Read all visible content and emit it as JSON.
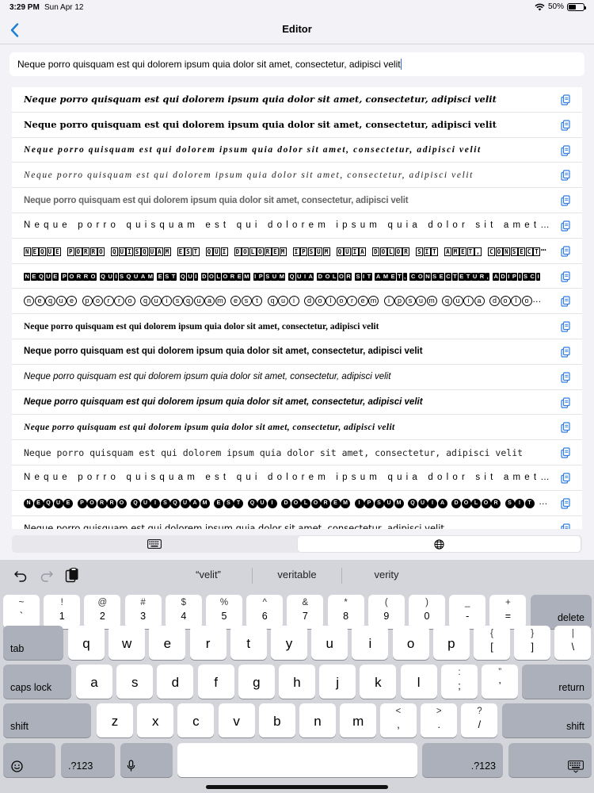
{
  "status": {
    "time": "3:29 PM",
    "date": "Sun Apr 12",
    "battery": "50%",
    "battery_level": 0.5
  },
  "nav": {
    "title": "Editor"
  },
  "input": {
    "value": "Neque porro quisquam est qui dolorem ipsum quia dolor sit amet, consectetur, adipisci velit"
  },
  "rows": [
    {
      "style": "fraktur",
      "text": "Neque porro quisquam est qui dolorem ipsum quia dolor sit amet, consectetur, adipisci velit"
    },
    {
      "style": "fraktur-bold",
      "text": "Neque porro quisquam est qui dolorem ipsum quia dolor sit amet, consectetur, adipisci velit"
    },
    {
      "style": "script-bold",
      "text": "Neque porro quisquam est qui dolorem ipsum quia dolor sit amet, consectetur, adipisci velit"
    },
    {
      "style": "script",
      "text": "Neque porro quisquam est qui dolorem ipsum quia dolor sit amet, consectetur, adipisci velit"
    },
    {
      "style": "double-struck",
      "text": "Neque porro quisquam est qui dolorem ipsum quia dolor sit amet, consectetur, adipisci velit"
    },
    {
      "style": "wide",
      "text": "Neque porro quisquam est qui dolorem ipsum quia dolor sit amet, consectetur, adipisci velit"
    },
    {
      "style": "squared",
      "text": "NEQUE PORRO QUISQUAM EST QUI DOLOREM IPSUM QUIA DOLOR SIT AMET, CONSECTETUR, ADIPISCI VELIT"
    },
    {
      "style": "negative-squared",
      "text": "NEQUE PORRO QUISQUAM EST QUI DOLOREM IPSUM QUIA DOLOR SIT AMET, CONSECTETUR, ADIPISCI VELIT"
    },
    {
      "style": "circled",
      "text": "neque porro quisquam est qui dolorem ipsum quia dolor sit amet, consectetur, adipisci velit"
    },
    {
      "style": "serif-bold",
      "text": "Neque porro quisquam est qui dolorem ipsum quia dolor sit amet, consectetur, adipisci velit"
    },
    {
      "style": "sans-bold",
      "text": "Neque porro quisquam est qui dolorem ipsum quia dolor sit amet, consectetur, adipisci velit"
    },
    {
      "style": "sans-italic",
      "text": "Neque porro quisquam est qui dolorem ipsum quia dolor sit amet, consectetur, adipisci velit"
    },
    {
      "style": "sans-bold-italic",
      "text": "Neque porro quisquam est qui dolorem ipsum quia dolor sit amet, consectetur, adipisci velit"
    },
    {
      "style": "serif-bold-italic",
      "text": "Neque porro quisquam est qui dolorem ipsum quia dolor sit amet, consectetur, adipisci velit"
    },
    {
      "style": "monospace",
      "text": "Neque porro quisquam est qui dolorem ipsum quia dolor sit amet, consectetur, adipisci velit"
    },
    {
      "style": "wide2",
      "text": "Neque porro quisquam est qui dolorem ipsum quia dolor sit amet, consectetur, adipisci velit"
    },
    {
      "style": "negative-circled",
      "text": "NEQUE PORRO QUISQUAM EST QUI DOLOREM IPSUM QUIA DOLOR SIT AMET, CONSECTETUR, ADIPISCI VELIT"
    },
    {
      "style": "small",
      "text": "Neque porro quisquam est qui dolorem ipsum quia dolor sit amet, consectetur, adipisci velit"
    }
  ],
  "segments": [
    {
      "icon": "keyboard-icon",
      "selected": false
    },
    {
      "icon": "globe-icon",
      "selected": true
    }
  ],
  "suggestions": [
    "“velit”",
    "veritable",
    "verity"
  ],
  "keyboard": {
    "row1": [
      [
        "~",
        "`"
      ],
      [
        "!",
        "1"
      ],
      [
        "@",
        "2"
      ],
      [
        "#",
        "3"
      ],
      [
        "$",
        "4"
      ],
      [
        "%",
        "5"
      ],
      [
        "^",
        "6"
      ],
      [
        "&",
        "7"
      ],
      [
        "*",
        "8"
      ],
      [
        "(",
        "9"
      ],
      [
        ")",
        "0"
      ],
      [
        "_",
        "-"
      ],
      [
        "+",
        "="
      ]
    ],
    "delete": "delete",
    "tab": "tab",
    "row2": [
      "q",
      "w",
      "e",
      "r",
      "t",
      "y",
      "u",
      "i",
      "o",
      "p"
    ],
    "row2_extra": [
      [
        "{",
        "["
      ],
      [
        "}",
        "]"
      ],
      [
        "|",
        "\\"
      ]
    ],
    "caps": "caps lock",
    "row3": [
      "a",
      "s",
      "d",
      "f",
      "g",
      "h",
      "j",
      "k",
      "l"
    ],
    "row3_extra": [
      [
        ":",
        ";"
      ],
      [
        "”",
        "’"
      ]
    ],
    "return": "return",
    "shift": "shift",
    "row4": [
      "z",
      "x",
      "c",
      "v",
      "b",
      "n",
      "m"
    ],
    "row4_extra": [
      [
        "<",
        ","
      ],
      [
        ">",
        "."
      ],
      [
        "?",
        "/"
      ]
    ],
    "num": ".?123"
  }
}
